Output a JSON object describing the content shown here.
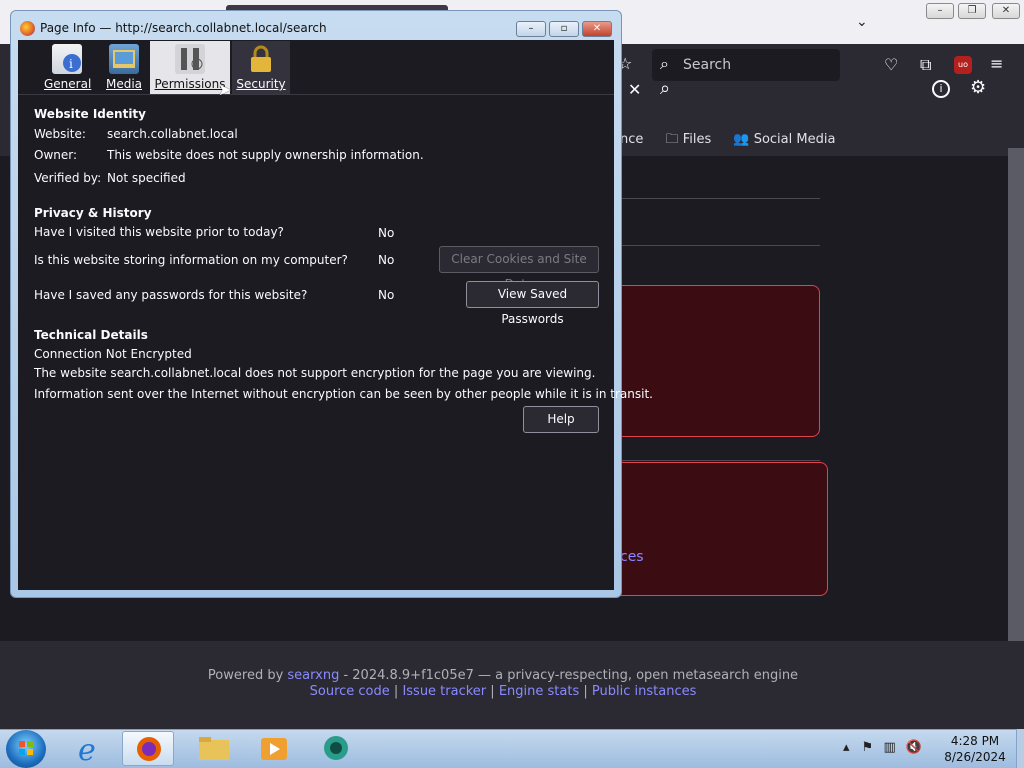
{
  "dialog": {
    "title": "Page Info — http://search.collabnet.local/search",
    "tabs": [
      {
        "label": "General"
      },
      {
        "label": "Media"
      },
      {
        "label": "Permissions"
      },
      {
        "label": "Security"
      }
    ],
    "identity": {
      "heading": "Website Identity",
      "website_label": "Website:",
      "website_value": "search.collabnet.local",
      "owner_label": "Owner:",
      "owner_value": "This website does not supply ownership information.",
      "verified_label": "Verified by:",
      "verified_value": "Not specified"
    },
    "privacy": {
      "heading": "Privacy & History",
      "visited_q": "Have I visited this website prior to today?",
      "visited_a": "No",
      "storing_q": "Is this website storing information on my computer?",
      "storing_a": "No",
      "clear_btn": "Clear Cookies and Site Data",
      "passwords_q": "Have I saved any passwords for this website?",
      "passwords_a": "No",
      "view_btn": "View Saved Passwords"
    },
    "technical": {
      "heading": "Technical Details",
      "line1": "Connection Not Encrypted",
      "line2": "The website search.collabnet.local does not support encryption for the page you are viewing.",
      "line3": "Information sent over the Internet without encryption can be seen by other people while it is in transit."
    },
    "help_btn": "Help"
  },
  "browser": {
    "search_placeholder": "Search",
    "categories": [
      "nce",
      "Files",
      "Social Media"
    ],
    "instance_fragment": "ces",
    "footer": {
      "powered_prefix": "Powered by ",
      "searxng": "searxng",
      "powered_suffix": " - 2024.8.9+f1c05e7 — a privacy-respecting, open metasearch engine",
      "links": [
        "Source code",
        "Issue tracker",
        "Engine stats",
        "Public instances"
      ]
    }
  },
  "taskbar": {
    "time": "4:28 PM",
    "date": "8/26/2024"
  }
}
